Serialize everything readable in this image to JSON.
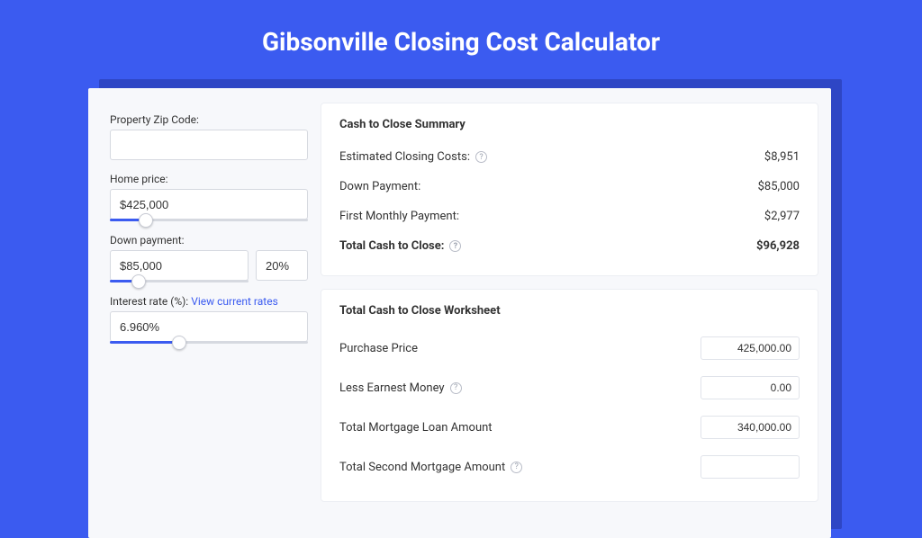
{
  "header": {
    "title": "Gibsonville Closing Cost Calculator"
  },
  "form": {
    "zip": {
      "label": "Property Zip Code:",
      "value": ""
    },
    "home_price": {
      "label": "Home price:",
      "value": "$425,000",
      "slider_pct": 18
    },
    "down_payment": {
      "label": "Down payment:",
      "value": "$85,000",
      "pct_value": "20%",
      "slider_pct": 21
    },
    "interest_rate": {
      "label": "Interest rate (%):",
      "link_text": "View current rates",
      "value": "6.960%",
      "slider_pct": 35
    }
  },
  "summary": {
    "title": "Cash to Close Summary",
    "rows": [
      {
        "label": "Estimated Closing Costs:",
        "help": true,
        "value": "$8,951",
        "bold": false
      },
      {
        "label": "Down Payment:",
        "help": false,
        "value": "$85,000",
        "bold": false
      },
      {
        "label": "First Monthly Payment:",
        "help": false,
        "value": "$2,977",
        "bold": false
      },
      {
        "label": "Total Cash to Close:",
        "help": true,
        "value": "$96,928",
        "bold": true
      }
    ]
  },
  "worksheet": {
    "title": "Total Cash to Close Worksheet",
    "rows": [
      {
        "label": "Purchase Price",
        "help": false,
        "value": "425,000.00"
      },
      {
        "label": "Less Earnest Money",
        "help": true,
        "value": "0.00"
      },
      {
        "label": "Total Mortgage Loan Amount",
        "help": false,
        "value": "340,000.00"
      },
      {
        "label": "Total Second Mortgage Amount",
        "help": true,
        "value": ""
      }
    ]
  }
}
